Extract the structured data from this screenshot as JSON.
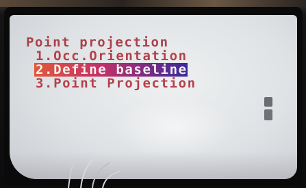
{
  "screen": {
    "menu_title": "Point projection",
    "items": [
      {
        "label": "1.Occ.Orientation",
        "selected": false
      },
      {
        "label": "2.Define baseline",
        "selected": true
      },
      {
        "label": "3.Point Projection",
        "selected": false
      }
    ]
  },
  "colors": {
    "text": "#b5404a",
    "selection_start": "#e05a3a",
    "selection_end": "#3a2a9a",
    "screen_bg": "#e6e8ea"
  },
  "icons": {
    "scrollbar": "scrollbar-thumb"
  }
}
